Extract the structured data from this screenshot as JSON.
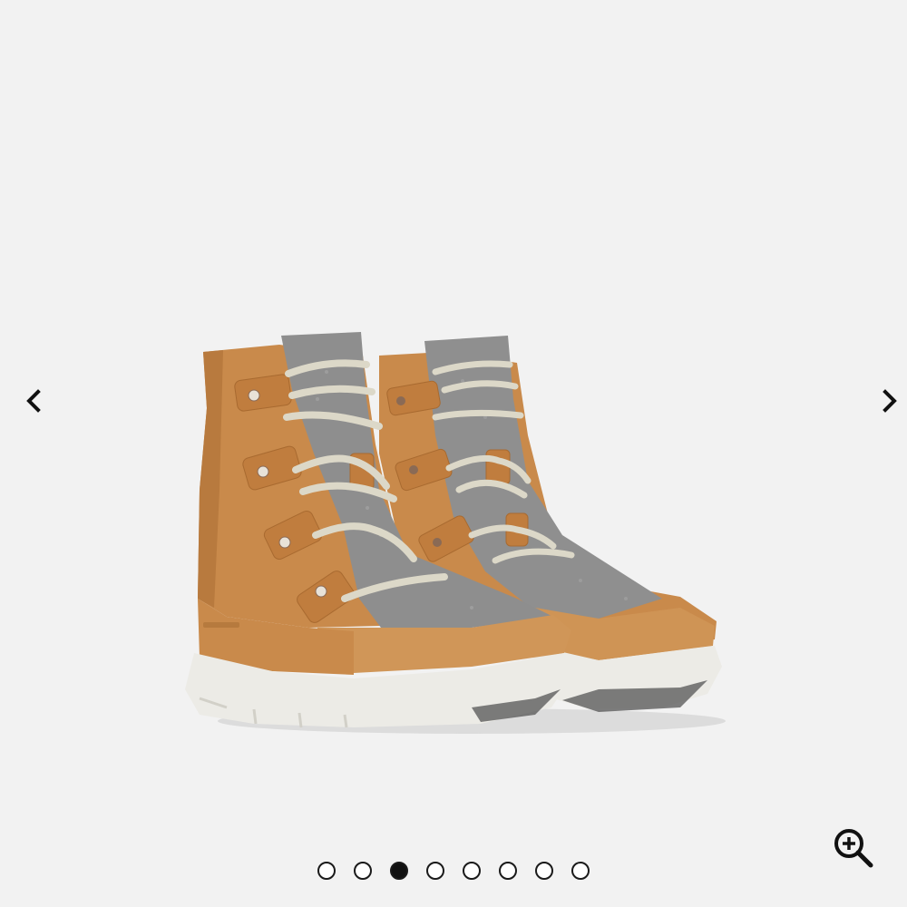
{
  "gallery": {
    "image_subject": "boot-pair",
    "slide_count": 8,
    "active_slide_index": 2,
    "colors": {
      "background": "#f2f2f2",
      "leather": "#c98a4b",
      "felt": "#8e8e8e",
      "sole": "#ecebe6",
      "laces": "#dcd8c8",
      "controls": "#111111"
    }
  },
  "controls": {
    "prev_icon": "chevron-left-icon",
    "next_icon": "chevron-right-icon",
    "zoom_icon": "zoom-in-icon"
  }
}
